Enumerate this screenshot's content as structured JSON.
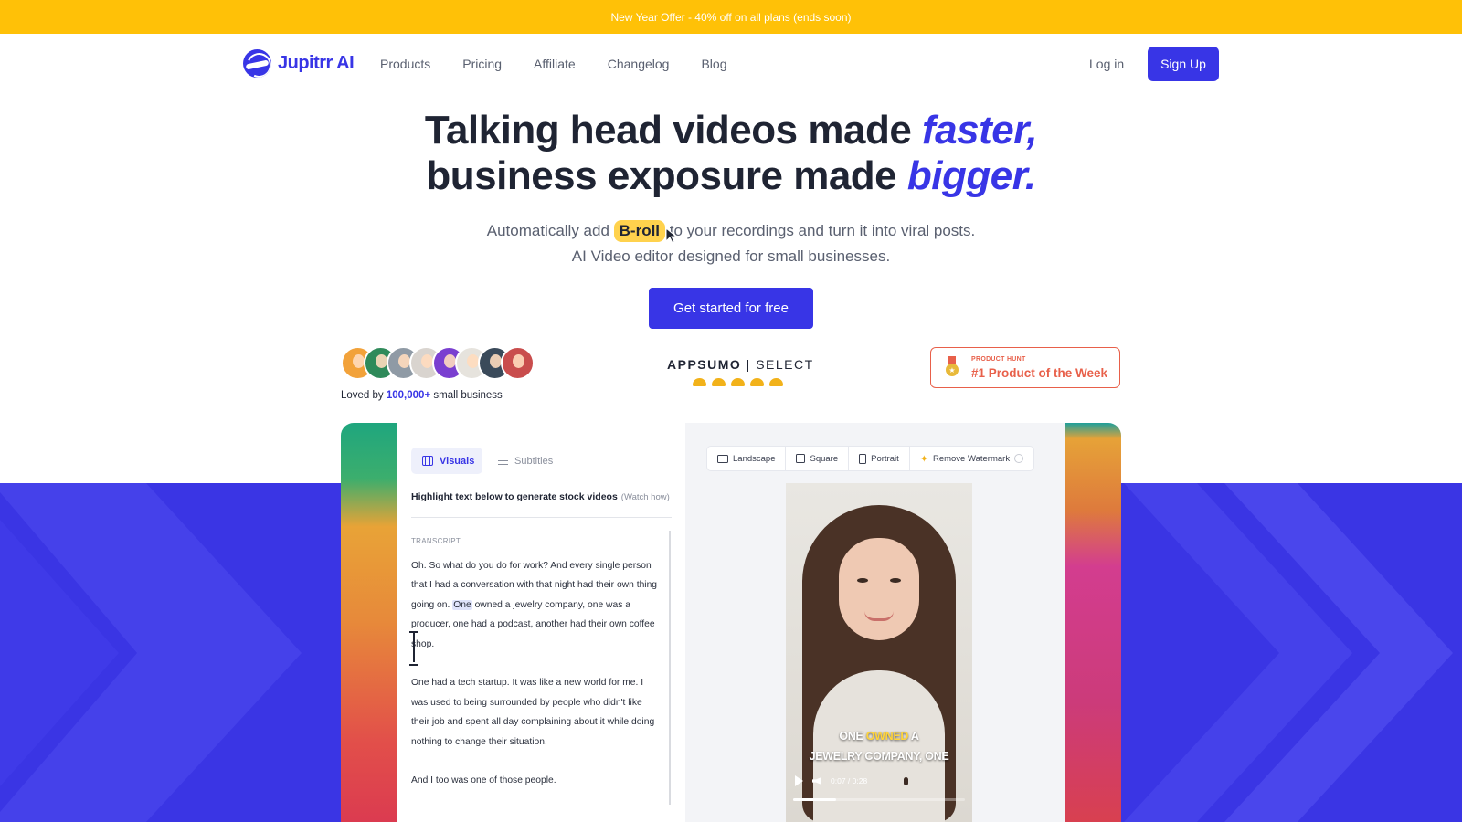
{
  "promo": {
    "text": "New Year Offer - 40% off on all plans (ends soon)"
  },
  "nav": {
    "logo": "Jupitrr AI",
    "links": [
      "Products",
      "Pricing",
      "Affiliate",
      "Changelog",
      "Blog"
    ],
    "login": "Log in",
    "signup": "Sign Up"
  },
  "hero": {
    "line1_plain": "Talking head videos made ",
    "line1_em": "faster,",
    "line2_plain": "business exposure made ",
    "line2_em": "bigger.",
    "sub_before": "Automatically add ",
    "sub_highlight": "B-roll",
    "sub_after": " to your recordings and turn it into viral posts.",
    "sub_line2": "AI Video editor designed for small businesses.",
    "cta": "Get started for free"
  },
  "social_proof": {
    "loved_prefix": "Loved by ",
    "loved_count": "100,000+",
    "loved_suffix": " small business",
    "avatar_colors": [
      "#f2a23a",
      "#2f8a5a",
      "#8f9aa5",
      "#d9d4cf",
      "#7a3fd0",
      "#e6e3dd",
      "#3a4a5a",
      "#c94d4d"
    ],
    "appsumo_brand": "APPSUMO",
    "appsumo_select": "SELECT",
    "taco_count": 5,
    "ph_small": "PRODUCT HUNT",
    "ph_big": "#1 Product of the Week"
  },
  "editor": {
    "tab_visuals": "Visuals",
    "tab_subtitles": "Subtitles",
    "hint": "Highlight text below to generate stock videos",
    "watch_how": "(Watch how)",
    "transcript_label": "TRANSCRIPT",
    "p1_before": "Oh. So what do you do for work? And every single person that I had a conversation with that night had their own thing going on. ",
    "p1_highlight": "One",
    "p1_after": " owned a jewelry company, one was a producer, one had a podcast, another had their own coffee shop.",
    "p2": "One had a tech startup. It was like a new world for me. I was used to being surrounded by people who didn't like their job and spent all day complaining about it while doing nothing to change their situation.",
    "p3": "And I too was one of those people."
  },
  "preview": {
    "formats": [
      "Landscape",
      "Square",
      "Portrait"
    ],
    "remove_watermark": "Remove Watermark",
    "caption_line1_a": "ONE ",
    "caption_line1_hi": "OWNED",
    "caption_line1_b": " A",
    "caption_line2": "JEWELRY COMPANY, ONE",
    "time": "0:07 / 0:28",
    "progress_fraction": 0.25
  },
  "colors": {
    "brand": "#3835e6",
    "promo": "#ffc107",
    "accent_red": "#e8604a"
  }
}
